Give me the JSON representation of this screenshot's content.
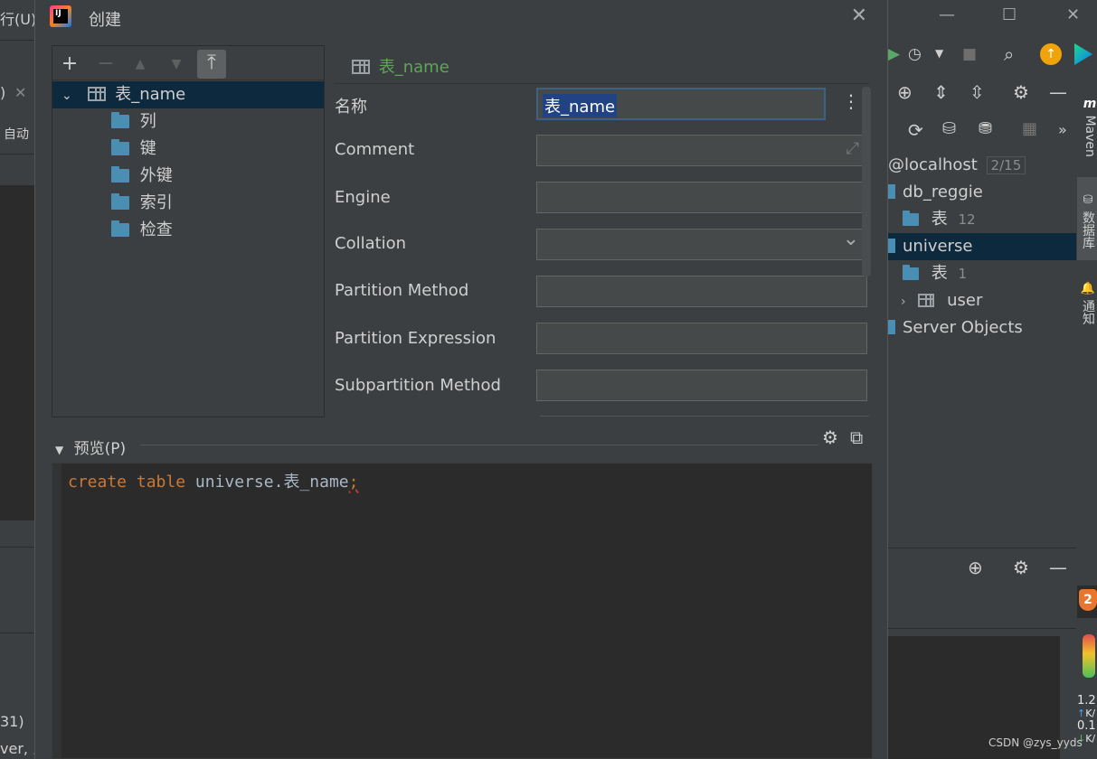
{
  "ide_left": {
    "menu_fragment": "行(U)",
    "tab_fragment": ")",
    "tab_close": "✕",
    "auto_label": "自动",
    "bottom_line1": "31)",
    "bottom_line2": "ver, 乡"
  },
  "ide_right": {
    "window_controls": {
      "minimize": "—",
      "maximize": "☐",
      "close": "✕"
    },
    "db_tree": [
      {
        "label": "@localhost",
        "count": "2/15"
      },
      {
        "label": "db_reggie"
      },
      {
        "label": "表",
        "count": "12"
      },
      {
        "label": "universe"
      },
      {
        "label": "表",
        "count": "1"
      },
      {
        "label": "user"
      },
      {
        "label": "Server Objects"
      }
    ],
    "side_tabs": {
      "maven": "Maven",
      "database": "数据库",
      "notifications": "通知"
    },
    "speed": {
      "value1": "1.2",
      "unit1": "K/",
      "value2": "0.1",
      "unit2": "K/"
    },
    "badge": "2"
  },
  "dialog": {
    "title": "创建",
    "close": "✕",
    "toolbar": {
      "add": "+",
      "remove": "−",
      "up": "▲",
      "down": "▼",
      "pin": "⤒"
    },
    "tree": {
      "root": "表_name",
      "children": [
        "列",
        "键",
        "外键",
        "索引",
        "检查"
      ]
    },
    "props_header": "表_name",
    "fields": {
      "name_label": "名称",
      "name_value": "表_name",
      "more": "⋮",
      "comment_label": "Comment",
      "comment_expand": "⤢",
      "engine_label": "Engine",
      "collation_label": "Collation",
      "collation_arrow": "⌄",
      "partition_method_label": "Partition Method",
      "partition_expression_label": "Partition Expression",
      "subpartition_method_label": "Subpartition Method"
    },
    "preview": {
      "arrow": "▼",
      "label": "预览(P)",
      "code_kw1": "create",
      "code_kw2": "table",
      "code_rest": "universe.表_name",
      "code_semicolon": ";"
    }
  },
  "watermark": "CSDN @zys_yyds"
}
